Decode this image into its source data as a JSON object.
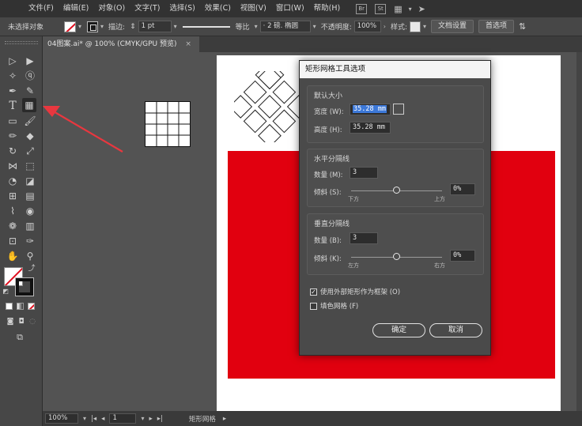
{
  "menubar": {
    "items": [
      "文件(F)",
      "编辑(E)",
      "对象(O)",
      "文字(T)",
      "选择(S)",
      "效果(C)",
      "视图(V)",
      "窗口(W)",
      "帮助(H)"
    ],
    "badges": [
      "Br",
      "St"
    ]
  },
  "controlbar": {
    "selection_label": "未选择对象",
    "stroke_label": "描边:",
    "stroke_weight": "1 pt",
    "profile_label": "等比",
    "brush_label": "· 2 磅. 椭圆",
    "opacity_label": "不透明度:",
    "opacity_value": "100%",
    "style_label": "样式:",
    "doc_setup_button": "文档设置",
    "preferences_button": "首选项"
  },
  "tab": {
    "title": "04图案.ai* @ 100% (CMYK/GPU 预览)",
    "close": "×"
  },
  "statusbar": {
    "zoom": "100%",
    "artboard": "1",
    "tool_name": "矩形网格"
  },
  "dialog": {
    "title": "矩形网格工具选项",
    "default_size": {
      "title": "默认大小",
      "width_label": "宽度 (W):",
      "width_value": "35.28 mm",
      "height_label": "高度 (H):",
      "height_value": "35.28 mm"
    },
    "horizontal": {
      "title": "水平分隔线",
      "count_label": "数量 (M):",
      "count_value": "3",
      "skew_label": "倾斜 (S):",
      "skew_value": "0%",
      "left_hint": "下方",
      "right_hint": "上方",
      "skew_level": 0
    },
    "vertical": {
      "title": "垂直分隔线",
      "count_label": "数量 (B):",
      "count_value": "3",
      "skew_label": "倾斜 (K):",
      "skew_value": "0%",
      "left_hint": "左方",
      "right_hint": "右方",
      "skew_level": 0
    },
    "use_outer_rect_label": "使用外部矩形作为框架 (O)",
    "use_outer_rect_checked": true,
    "fill_grid_label": "填色网格 (F)",
    "fill_grid_checked": false,
    "ok_button": "确定",
    "cancel_button": "取消"
  },
  "colors": {
    "red_fill": "#e1000f",
    "arrow": "#e8373f",
    "selection_highlight": "#3c78d8"
  }
}
